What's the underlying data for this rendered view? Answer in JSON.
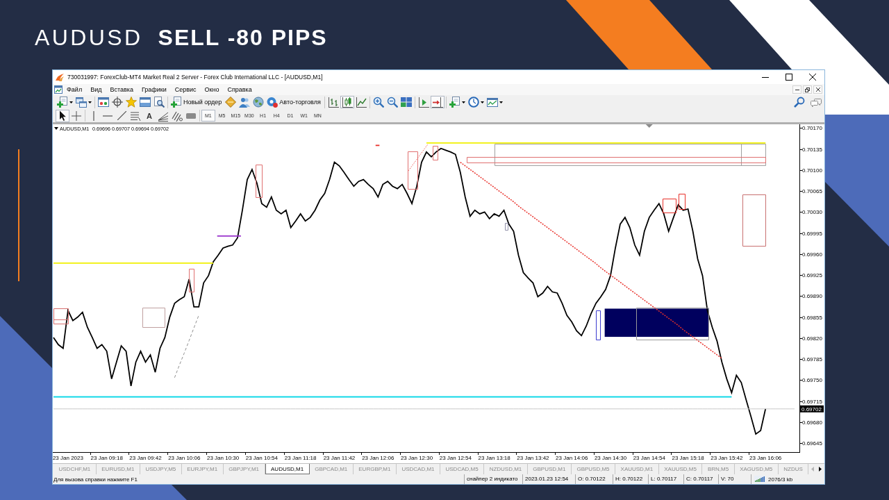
{
  "slide": {
    "symbol": "AUDUSD",
    "trade": "SELL -80 PIPS"
  },
  "window": {
    "title": "730031997: ForexClub-MT4 Market Real 2 Server - Forex Club International LLC - [AUDUSD,M1]"
  },
  "menu": {
    "items": [
      "Файл",
      "Вид",
      "Вставка",
      "Графики",
      "Сервис",
      "Окно",
      "Справка"
    ]
  },
  "toolbar": {
    "groups": [
      [
        {
          "kind": "new-chart",
          "pressed": false
        },
        {
          "kind": "profiles",
          "pressed": false
        }
      ],
      [
        {
          "kind": "market-watch",
          "pressed": false
        },
        {
          "kind": "data-window",
          "pressed": false
        },
        {
          "kind": "navigator",
          "pressed": false
        },
        {
          "kind": "terminal",
          "pressed": false
        },
        {
          "kind": "tester",
          "pressed": false
        }
      ],
      [
        {
          "kind": "new-order",
          "label": "Новый ордер",
          "pressed": false
        },
        {
          "kind": "metaeditor",
          "pressed": false
        },
        {
          "kind": "signals",
          "pressed": false
        },
        {
          "kind": "market",
          "pressed": false
        },
        {
          "kind": "autotrading",
          "label": "Авто-торговля",
          "pressed": false
        }
      ],
      [
        {
          "kind": "bar-chart",
          "pressed": false
        },
        {
          "kind": "candles",
          "pressed": true
        },
        {
          "kind": "line-chart",
          "pressed": false
        }
      ],
      [
        {
          "kind": "zoom-in",
          "pressed": false
        },
        {
          "kind": "zoom-out",
          "pressed": false
        },
        {
          "kind": "tile",
          "pressed": false
        }
      ],
      [
        {
          "kind": "chart-shift",
          "pressed": false
        },
        {
          "kind": "autoscroll",
          "pressed": true
        }
      ],
      [
        {
          "kind": "indicators",
          "pressed": false
        },
        {
          "kind": "periods",
          "pressed": false
        },
        {
          "kind": "templates",
          "pressed": false
        }
      ]
    ],
    "right": [
      {
        "kind": "search",
        "pressed": false
      },
      {
        "kind": "chat",
        "pressed": false
      }
    ]
  },
  "drawing_toolbar": {
    "groups": [
      [
        {
          "kind": "cursor",
          "pressed": true
        },
        {
          "kind": "crosshair",
          "pressed": false
        }
      ],
      [
        {
          "kind": "vertical-line",
          "pressed": false
        },
        {
          "kind": "horizontal-line",
          "pressed": false
        },
        {
          "kind": "trendline",
          "pressed": false
        },
        {
          "kind": "channel",
          "pressed": false
        },
        {
          "kind": "text",
          "label": "A",
          "pressed": false
        },
        {
          "kind": "fan",
          "pressed": false
        },
        {
          "kind": "hatched",
          "pressed": false
        },
        {
          "kind": "label",
          "pressed": false
        }
      ]
    ],
    "periods": [
      {
        "label": "M1",
        "selected": true
      },
      {
        "label": "M5",
        "selected": false
      },
      {
        "label": "M15",
        "selected": false
      },
      {
        "label": "M30",
        "selected": false
      },
      {
        "label": "H1",
        "selected": false
      },
      {
        "label": "H4",
        "selected": false
      },
      {
        "label": "D1",
        "selected": false
      },
      {
        "label": "W1",
        "selected": false
      },
      {
        "label": "MN",
        "selected": false
      }
    ]
  },
  "chart": {
    "ohlc": "0.69696 0.69707 0.69694 0.69702",
    "current_price": "0.69702",
    "chart_data": {
      "type": "line",
      "ylim": [
        0.6963,
        0.70175
      ],
      "yticks": [
        {
          "value": 0.7017,
          "label": "0.70170"
        },
        {
          "value": 0.70135,
          "label": "0.70135"
        },
        {
          "value": 0.701,
          "label": "0.70100"
        },
        {
          "value": 0.70065,
          "label": "0.70065"
        },
        {
          "value": 0.7003,
          "label": "0.70030"
        },
        {
          "value": 0.69995,
          "label": "0.69995"
        },
        {
          "value": 0.6996,
          "label": "0.69960"
        },
        {
          "value": 0.69925,
          "label": "0.69925"
        },
        {
          "value": 0.6989,
          "label": "0.69890"
        },
        {
          "value": 0.69855,
          "label": "0.69855"
        },
        {
          "value": 0.6982,
          "label": "0.69820"
        },
        {
          "value": 0.69785,
          "label": "0.69785"
        },
        {
          "value": 0.6975,
          "label": "0.69750"
        },
        {
          "value": 0.69715,
          "label": "0.69715"
        },
        {
          "value": 0.6968,
          "label": "0.69680"
        },
        {
          "value": 0.69645,
          "label": "0.69645"
        }
      ],
      "categories": [
        null,
        null,
        null,
        "23 Jan 2023",
        null,
        null,
        null,
        null,
        null,
        null,
        null,
        "23 Jan 09:18",
        null,
        null,
        null,
        null,
        null,
        null,
        null,
        "23 Jan 09:42",
        null,
        null,
        null,
        null,
        null,
        null,
        null,
        "23 Jan 10:06",
        null,
        null,
        null,
        null,
        null,
        null,
        null,
        "23 Jan 10:30",
        null,
        null,
        null,
        null,
        null,
        null,
        null,
        "23 Jan 10:54",
        null,
        null,
        null,
        null,
        null,
        null,
        null,
        "23 Jan 11:18",
        null,
        null,
        null,
        null,
        null,
        null,
        null,
        "23 Jan 11:42",
        null,
        null,
        null,
        null,
        null,
        null,
        null,
        "23 Jan 12:06",
        null,
        null,
        null,
        null,
        null,
        null,
        null,
        "23 Jan 12:30",
        null,
        null,
        null,
        null,
        null,
        null,
        null,
        "23 Jan 12:54",
        null,
        null,
        null,
        null,
        null,
        null,
        null,
        "23 Jan 13:18",
        null,
        null,
        null,
        null,
        null,
        null,
        null,
        "23 Jan 13:42",
        null,
        null,
        null,
        null,
        null,
        null,
        null,
        "23 Jan 14:06",
        null,
        null,
        null,
        null,
        null,
        null,
        null,
        "23 Jan 14:30",
        null,
        null,
        null,
        null,
        null,
        null,
        null,
        "23 Jan 14:54",
        null,
        null,
        null,
        null,
        null,
        null,
        null,
        "23 Jan 15:18",
        null,
        null,
        null,
        null,
        null,
        null,
        null,
        "23 Jan 15:42",
        null,
        null,
        null,
        null,
        null,
        null,
        null,
        "23 Jan 16:06",
        null,
        null,
        null,
        null,
        null,
        null
      ],
      "series": [
        {
          "name": "AUDUSD,M1",
          "color": "#000000",
          "values": [
            0.69821,
            0.69809,
            0.69803,
            0.69866,
            0.69849,
            0.69855,
            0.69863,
            0.69838,
            0.69821,
            0.69803,
            0.69809,
            0.69798,
            0.69752,
            0.6978,
            0.69807,
            0.69798,
            0.6974,
            0.6978,
            0.69798,
            0.6978,
            0.69792,
            0.69763,
            0.69803,
            0.69821,
            0.69855,
            0.69878,
            0.69884,
            0.69889,
            0.69918,
            0.69872,
            0.69872,
            0.69912,
            0.69924,
            0.69947,
            0.69958,
            0.6997,
            0.69973,
            0.69975,
            0.69987,
            0.70033,
            0.70084,
            0.70101,
            0.70078,
            0.70044,
            0.70038,
            0.70055,
            0.70033,
            0.70027,
            0.70033,
            0.70004,
            0.70015,
            0.70027,
            0.70015,
            0.70021,
            0.70033,
            0.7005,
            0.70061,
            0.70084,
            0.70113,
            0.70107,
            0.70096,
            0.70084,
            0.70073,
            0.70081,
            0.70084,
            0.70076,
            0.70069,
            0.70055,
            0.70076,
            0.70081,
            0.70073,
            0.70069,
            0.70076,
            0.70061,
            0.70044,
            0.70073,
            0.70113,
            0.7013,
            0.70122,
            0.7013,
            0.70136,
            0.70133,
            0.7013,
            0.70126,
            0.70096,
            0.70055,
            0.70023,
            0.70033,
            0.70027,
            0.7003,
            0.70019,
            0.70027,
            0.70023,
            0.70033,
            0.7001,
            0.69998,
            0.69958,
            0.69929,
            0.6992,
            0.69912,
            0.69889,
            0.69895,
            0.69906,
            0.69897,
            0.69895,
            0.69878,
            0.69858,
            0.69847,
            0.69832,
            0.69824,
            0.6984,
            0.69861,
            0.69878,
            0.69889,
            0.69901,
            0.69924,
            0.6997,
            0.7001,
            0.70021,
            0.70004,
            0.69975,
            0.69958,
            0.69998,
            0.70021,
            0.70033,
            0.70044,
            0.70027,
            0.69998,
            0.70021,
            0.70042,
            0.70033,
            0.70035,
            0.69998,
            0.69952,
            0.69924,
            0.69866,
            0.69838,
            0.69815,
            0.6978,
            0.69752,
            0.69729,
            0.69758,
            0.69746,
            0.69717,
            0.69689,
            0.6966,
            0.69666,
            0.69702,
            null,
            null,
            null,
            null,
            null,
            null
          ]
        },
        {
          "color": "#e8302a",
          "line_style": "dotted",
          "values": [
            null,
            null,
            null,
            null,
            null,
            null,
            null,
            null,
            null,
            null,
            null,
            null,
            null,
            null,
            null,
            null,
            null,
            null,
            null,
            null,
            null,
            null,
            null,
            null,
            null,
            null,
            null,
            null,
            null,
            null,
            null,
            null,
            null,
            null,
            null,
            null,
            null,
            null,
            null,
            null,
            null,
            null,
            null,
            null,
            null,
            null,
            null,
            null,
            null,
            null,
            null,
            null,
            null,
            null,
            null,
            null,
            null,
            null,
            null,
            null,
            null,
            null,
            null,
            null,
            null,
            null,
            null,
            null,
            null,
            null,
            null,
            null,
            null,
            null,
            null,
            null,
            null,
            null,
            null,
            null,
            null,
            null,
            null,
            null,
            0.70113,
            0.70107,
            0.70101,
            0.70095,
            0.70089,
            0.70083,
            0.70077,
            0.70071,
            0.70065,
            0.70059,
            0.70053,
            0.70047,
            0.7004,
            0.70034,
            0.70028,
            0.70022,
            0.70016,
            0.7001,
            0.70004,
            0.69998,
            0.69992,
            0.69986,
            0.6998,
            0.69974,
            0.69968,
            0.69962,
            0.69956,
            0.6995,
            0.69944,
            0.69937,
            0.69931,
            0.69925,
            0.69919,
            0.69913,
            0.69907,
            0.69901,
            0.69895,
            0.69889,
            0.69883,
            0.69877,
            0.69871,
            0.69865,
            0.69859,
            0.69853,
            0.69847,
            0.69841,
            0.69834,
            0.69828,
            0.69822,
            0.69816,
            0.6981,
            0.69804,
            0.69798,
            0.69792,
            0.69786,
            null,
            null,
            null,
            null,
            null,
            null,
            null,
            null,
            null,
            null,
            null,
            null,
            null,
            null,
            null
          ]
        },
        {
          "color": "#909090",
          "line_style": "dashed",
          "values": [
            null,
            null,
            null,
            null,
            null,
            null,
            null,
            null,
            null,
            null,
            null,
            null,
            null,
            null,
            null,
            null,
            null,
            null,
            null,
            null,
            null,
            null,
            null,
            null,
            null,
            0.69754,
            0.69775,
            0.69795,
            0.69816,
            0.69837,
            0.69858,
            null,
            null,
            null,
            null,
            null,
            null,
            null,
            null,
            null,
            null,
            null,
            null,
            null,
            null,
            null,
            null,
            null,
            null,
            null,
            null,
            null,
            null,
            null,
            null,
            null,
            null,
            null,
            null,
            null,
            null,
            null,
            null,
            null,
            null,
            null,
            null,
            null,
            null,
            null,
            null,
            null,
            null,
            null,
            null,
            null,
            null,
            null,
            null,
            null,
            null,
            null,
            null,
            null,
            null,
            null,
            null,
            null,
            null,
            null,
            null,
            null,
            null,
            null,
            null,
            null,
            null,
            null,
            null,
            null,
            null,
            null,
            null,
            null,
            null,
            null,
            null,
            null,
            null,
            null,
            null,
            null,
            null,
            null,
            null,
            null,
            null,
            null,
            null,
            null,
            null,
            null,
            null,
            null,
            null,
            null,
            null,
            null,
            null,
            null,
            null,
            null,
            null,
            null,
            null,
            null,
            null,
            null,
            null,
            null,
            null,
            null,
            null,
            null,
            null,
            null,
            null,
            null,
            null,
            null,
            null,
            null,
            null,
            null
          ]
        },
        {
          "color": "#f0f000",
          "values": [
            0.69945,
            0.69945,
            0.69945,
            0.69945,
            0.69945,
            0.69945,
            0.69945,
            0.69945,
            0.69945,
            0.69945,
            0.69945,
            0.69945,
            0.69945,
            0.69945,
            0.69945,
            0.69945,
            0.69945,
            0.69945,
            0.69945,
            0.69945,
            0.69945,
            0.69945,
            0.69945,
            0.69945,
            0.69945,
            0.69945,
            0.69945,
            0.69945,
            0.69945,
            0.69945,
            0.69945,
            0.69945,
            0.69945,
            0.69945,
            null,
            null,
            null,
            null,
            null,
            null,
            null,
            null,
            null,
            null,
            null,
            null,
            null,
            null,
            null,
            null,
            null,
            null,
            null,
            null,
            null,
            null,
            null,
            null,
            null,
            null,
            null,
            null,
            null,
            null,
            null,
            null,
            null,
            null,
            null,
            null,
            null,
            null,
            null,
            null,
            null,
            null,
            null,
            null,
            null,
            null,
            null,
            null,
            null,
            null,
            null,
            null,
            null,
            null,
            null,
            null,
            null,
            null,
            null,
            null,
            null,
            null,
            null,
            null,
            null,
            null,
            null,
            null,
            null,
            null,
            null,
            null,
            null,
            null,
            null,
            null,
            null,
            null,
            null,
            null,
            null,
            null,
            null,
            null,
            null,
            null,
            null,
            null,
            null,
            null,
            null,
            null,
            null,
            null,
            null,
            null,
            null,
            null,
            null,
            null,
            null,
            null,
            null,
            null,
            null,
            null,
            null,
            null,
            null,
            null,
            null,
            null,
            null,
            null,
            null,
            null,
            null,
            null,
            null,
            null
          ]
        },
        {
          "color": "#10d8e8",
          "values": [
            0.69722,
            0.69722,
            0.69722,
            0.69722,
            0.69722,
            0.69722,
            0.69722,
            0.69722,
            0.69722,
            0.69722,
            0.69722,
            0.69722,
            0.69722,
            0.69722,
            0.69722,
            0.69722,
            0.69722,
            0.69722,
            0.69722,
            0.69722,
            0.69722,
            0.69722,
            0.69722,
            0.69722,
            0.69722,
            0.69722,
            0.69722,
            0.69722,
            0.69722,
            0.69722,
            0.69722,
            0.69722,
            0.69722,
            0.69722,
            0.69722,
            0.69722,
            0.69722,
            0.69722,
            0.69722,
            0.69722,
            0.69722,
            0.69722,
            0.69722,
            0.69722,
            0.69722,
            0.69722,
            0.69722,
            0.69722,
            0.69722,
            0.69722,
            0.69722,
            0.69722,
            0.69722,
            0.69722,
            0.69722,
            0.69722,
            0.69722,
            0.69722,
            0.69722,
            0.69722,
            0.69722,
            0.69722,
            0.69722,
            0.69722,
            0.69722,
            0.69722,
            0.69722,
            0.69722,
            0.69722,
            0.69722,
            0.69722,
            0.69722,
            0.69722,
            0.69722,
            0.69722,
            0.69722,
            0.69722,
            0.69722,
            0.69722,
            0.69722,
            0.69722,
            0.69722,
            0.69722,
            0.69722,
            0.69722,
            0.69722,
            0.69722,
            0.69722,
            0.69722,
            0.69722,
            0.69722,
            0.69722,
            0.69722,
            0.69722,
            0.69722,
            0.69722,
            0.69722,
            0.69722,
            0.69722,
            0.69722,
            0.69722,
            0.69722,
            0.69722,
            0.69722,
            0.69722,
            0.69722,
            0.69722,
            0.69722,
            0.69722,
            0.69722,
            0.69722,
            0.69722,
            0.69722,
            0.69722,
            0.69722,
            0.69722,
            0.69722,
            0.69722,
            0.69722,
            0.69722,
            0.69722,
            0.69722,
            0.69722,
            0.69722,
            0.69722,
            0.69722,
            0.69722,
            0.69722,
            0.69722,
            0.69722,
            0.69722,
            0.69722,
            0.69722,
            0.69722,
            0.69722,
            0.69722,
            0.69722,
            0.69722,
            0.69722,
            0.69722,
            0.69722,
            null,
            null,
            null,
            null,
            null,
            null,
            null,
            null,
            null,
            null,
            null,
            null,
            null
          ]
        },
        {
          "color": "#f0f000",
          "values": [
            null,
            null,
            null,
            null,
            null,
            null,
            null,
            null,
            null,
            null,
            null,
            null,
            null,
            null,
            null,
            null,
            null,
            null,
            null,
            null,
            null,
            null,
            null,
            null,
            null,
            null,
            null,
            null,
            null,
            null,
            null,
            null,
            null,
            null,
            null,
            null,
            null,
            null,
            null,
            null,
            null,
            null,
            null,
            null,
            null,
            null,
            null,
            null,
            null,
            null,
            null,
            null,
            null,
            null,
            null,
            null,
            null,
            null,
            null,
            null,
            null,
            null,
            null,
            null,
            null,
            null,
            null,
            null,
            null,
            null,
            null,
            null,
            null,
            null,
            null,
            null,
            null,
            0.70145,
            0.70145,
            0.70145,
            0.70145,
            0.70145,
            0.70145,
            0.70145,
            0.70145,
            0.70145,
            0.70145,
            0.70145,
            0.70145,
            0.70145,
            0.70145,
            0.70145,
            0.70145,
            0.70145,
            0.70145,
            0.70145,
            0.70145,
            0.70145,
            0.70145,
            0.70145,
            0.70145,
            0.70145,
            0.70145,
            0.70145,
            0.70145,
            0.70145,
            0.70145,
            0.70145,
            0.70145,
            0.70145,
            0.70145,
            0.70145,
            0.70145,
            0.70145,
            0.70145,
            0.70145,
            0.70145,
            0.70145,
            0.70145,
            0.70145,
            0.70145,
            0.70145,
            0.70145,
            0.70145,
            0.70145,
            0.70145,
            0.70145,
            0.70145,
            0.70145,
            0.70145,
            0.70145,
            0.70145,
            0.70145,
            0.70145,
            0.70145,
            0.70145,
            0.70145,
            0.70145,
            0.70145,
            0.70145,
            0.70145,
            0.70145,
            0.70145,
            0.70145,
            0.70145,
            0.70145,
            0.70145,
            0.70145,
            null,
            null,
            null,
            null,
            null,
            null
          ]
        },
        {
          "color": "#c8c8c8",
          "values": [
            0.69702,
            0.69702,
            0.69702,
            0.69702,
            0.69702,
            0.69702,
            0.69702,
            0.69702,
            0.69702,
            0.69702,
            0.69702,
            0.69702,
            0.69702,
            0.69702,
            0.69702,
            0.69702,
            0.69702,
            0.69702,
            0.69702,
            0.69702,
            0.69702,
            0.69702,
            0.69702,
            0.69702,
            0.69702,
            0.69702,
            0.69702,
            0.69702,
            0.69702,
            0.69702,
            0.69702,
            0.69702,
            0.69702,
            0.69702,
            0.69702,
            0.69702,
            0.69702,
            0.69702,
            0.69702,
            0.69702,
            0.69702,
            0.69702,
            0.69702,
            0.69702,
            0.69702,
            0.69702,
            0.69702,
            0.69702,
            0.69702,
            0.69702,
            0.69702,
            0.69702,
            0.69702,
            0.69702,
            0.69702,
            0.69702,
            0.69702,
            0.69702,
            0.69702,
            0.69702,
            0.69702,
            0.69702,
            0.69702,
            0.69702,
            0.69702,
            0.69702,
            0.69702,
            0.69702,
            0.69702,
            0.69702,
            0.69702,
            0.69702,
            0.69702,
            0.69702,
            0.69702,
            0.69702,
            0.69702,
            0.69702,
            0.69702,
            0.69702,
            0.69702,
            0.69702,
            0.69702,
            0.69702,
            0.69702,
            0.69702,
            0.69702,
            0.69702,
            0.69702,
            0.69702,
            0.69702,
            0.69702,
            0.69702,
            0.69702,
            0.69702,
            0.69702,
            0.69702,
            0.69702,
            0.69702,
            0.69702,
            0.69702,
            0.69702,
            0.69702,
            0.69702,
            0.69702,
            0.69702,
            0.69702,
            0.69702,
            0.69702,
            0.69702,
            0.69702,
            0.69702,
            0.69702,
            0.69702,
            0.69702,
            0.69702,
            0.69702,
            0.69702,
            0.69702,
            0.69702,
            0.69702,
            0.69702,
            0.69702,
            0.69702,
            0.69702,
            0.69702,
            0.69702,
            0.69702,
            0.69702,
            0.69702,
            0.69702,
            0.69702,
            0.69702,
            0.69702,
            0.69702,
            0.69702,
            0.69702,
            0.69702,
            0.69702,
            0.69702,
            0.69702,
            0.69702,
            0.69702,
            0.69702,
            0.69702,
            0.69702,
            0.69702,
            0.69702,
            0.69702,
            0.69702,
            0.69702,
            0.69702,
            0.69702,
            0.69702
          ]
        }
      ]
    }
  },
  "symbol_tabs": {
    "tabs": [
      {
        "label": "USDCHF,M1",
        "selected": false
      },
      {
        "label": "EURUSD,M1",
        "selected": false
      },
      {
        "label": "USDJPY,M5",
        "selected": false
      },
      {
        "label": "EURJPY,M1",
        "selected": false
      },
      {
        "label": "GBPJPY,M1",
        "selected": false
      },
      {
        "label": "AUDUSD,M1",
        "selected": true
      },
      {
        "label": "GBPCAD,M1",
        "selected": false
      },
      {
        "label": "EURGBP,M1",
        "selected": false
      },
      {
        "label": "USDCAD,M1",
        "selected": false
      },
      {
        "label": "USDCAD,M5",
        "selected": false
      },
      {
        "label": "NZDUSD,M1",
        "selected": false
      },
      {
        "label": "GBPUSD,M1",
        "selected": false
      },
      {
        "label": "GBPUSD,M5",
        "selected": false
      },
      {
        "label": "XAUUSD,M1",
        "selected": false
      },
      {
        "label": "XAUUSD,M5",
        "selected": false
      },
      {
        "label": "BRN,M5",
        "selected": false
      },
      {
        "label": "XAGUSD,M5",
        "selected": false
      },
      {
        "label": "NZDUS",
        "selected": false
      }
    ]
  },
  "status_bar": {
    "help": "Для вызова справки нажмите F1",
    "fields": [
      "снайпер 2 индикато",
      "2023.01.23 12:54",
      "O: 0.70122",
      "H: 0.70122",
      "L: 0.70117",
      "C: 0.70117",
      "V: 70"
    ],
    "traffic": "2076/3 kb"
  }
}
